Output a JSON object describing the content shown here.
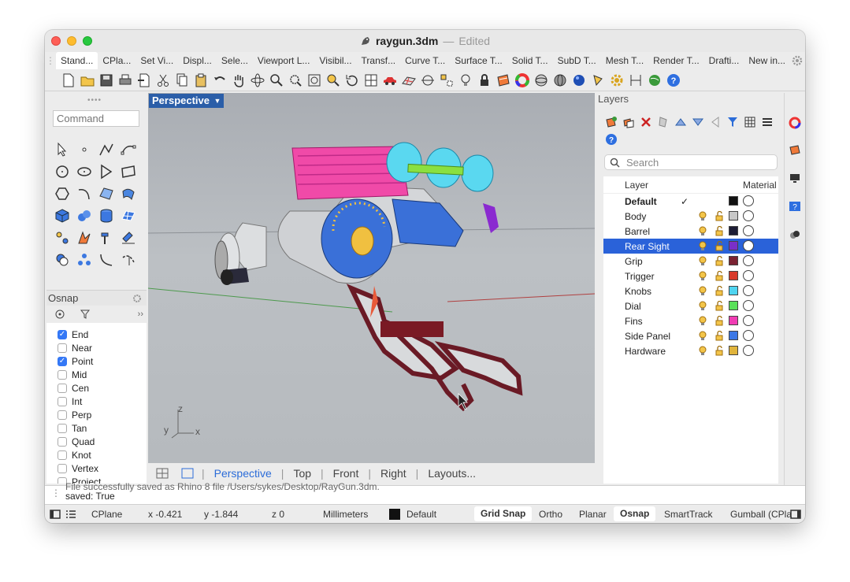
{
  "window": {
    "filename": "raygun.3dm",
    "separator": "—",
    "status": "Edited"
  },
  "tabs": [
    "Stand...",
    "CPla...",
    "Set Vi...",
    "Displ...",
    "Sele...",
    "Viewport L...",
    "Visibil...",
    "Transf...",
    "Curve T...",
    "Surface T...",
    "Solid T...",
    "SubD T...",
    "Mesh T...",
    "Render T...",
    "Drafti...",
    "New in..."
  ],
  "command": {
    "placeholder": "Command"
  },
  "osnap": {
    "title": "Osnap",
    "items": [
      {
        "label": "End",
        "checked": true
      },
      {
        "label": "Near",
        "checked": false
      },
      {
        "label": "Point",
        "checked": true
      },
      {
        "label": "Mid",
        "checked": false
      },
      {
        "label": "Cen",
        "checked": false
      },
      {
        "label": "Int",
        "checked": false
      },
      {
        "label": "Perp",
        "checked": false
      },
      {
        "label": "Tan",
        "checked": false
      },
      {
        "label": "Quad",
        "checked": false
      },
      {
        "label": "Knot",
        "checked": false
      },
      {
        "label": "Vertex",
        "checked": false
      },
      {
        "label": "Project",
        "checked": false
      }
    ]
  },
  "viewport": {
    "name": "Perspective",
    "axes": {
      "z": "z",
      "y": "y",
      "x": "x"
    },
    "tabs": [
      "Perspective",
      "Top",
      "Front",
      "Right",
      "Layouts..."
    ]
  },
  "layers": {
    "title": "Layers",
    "search_placeholder": "Search",
    "col_layer": "Layer",
    "col_material": "Material",
    "items": [
      {
        "name": "Default",
        "current": true,
        "color": "#111111"
      },
      {
        "name": "Body",
        "color": "#c8c8c8"
      },
      {
        "name": "Barrel",
        "color": "#1d1d35"
      },
      {
        "name": "Rear Sight",
        "color": "#7a2fc8",
        "selected": true
      },
      {
        "name": "Grip",
        "color": "#7a2232"
      },
      {
        "name": "Trigger",
        "color": "#d83a2a"
      },
      {
        "name": "Knobs",
        "color": "#4fd4f0"
      },
      {
        "name": "Dial",
        "color": "#5ae05a"
      },
      {
        "name": "Fins",
        "color": "#f03cb4"
      },
      {
        "name": "Side Panel",
        "color": "#3c78e6"
      },
      {
        "name": "Hardware",
        "color": "#e0b43c"
      }
    ],
    "check": "✓"
  },
  "command_history": {
    "line1": "File successfully saved as Rhino 8 file /Users/sykes/Desktop/RayGun.3dm.",
    "line2": "saved: True"
  },
  "status": {
    "cplane": "CPlane",
    "x": "x -0.421",
    "y": "y -1.844",
    "z": "z 0",
    "units": "Millimeters",
    "layer": "Default",
    "grid_snap": "Grid Snap",
    "ortho": "Ortho",
    "planar": "Planar",
    "osnap": "Osnap",
    "smarttrack": "SmartTrack",
    "gumball": "Gumball (CPla"
  }
}
